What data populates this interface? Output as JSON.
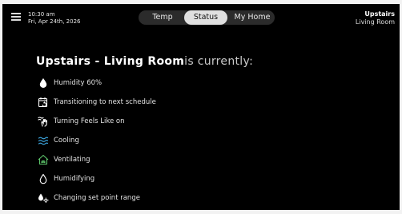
{
  "datetime": {
    "time": "10:30 am",
    "date": "Fri, Apr 24th, 2026"
  },
  "tabs": [
    {
      "label": "Temp"
    },
    {
      "label": "Status"
    },
    {
      "label": "My Home"
    }
  ],
  "location": {
    "floor": "Upstairs",
    "room": "Living Room"
  },
  "headline": {
    "room": "Upstairs - Living Room",
    "suffix": "is currently:"
  },
  "status_items": [
    {
      "icon": "water-drop-icon",
      "label": "Humidity 60%"
    },
    {
      "icon": "calendar-schedule-icon",
      "label": "Transitioning to next schedule"
    },
    {
      "icon": "hand-wave-icon",
      "label": "Turning Feels Like on"
    },
    {
      "icon": "cooling-waves-icon",
      "label": "Cooling"
    },
    {
      "icon": "home-fan-icon",
      "label": "Ventilating"
    },
    {
      "icon": "humidifier-drop-icon",
      "label": "Humidifying"
    },
    {
      "icon": "setpoint-range-icon",
      "label": "Changing set point range"
    }
  ],
  "colors": {
    "background": "#000000",
    "text": "#ffffff",
    "cooling_accent": "#3aa0d8",
    "ventilating_accent": "#5cc36a",
    "active_tab": "#e0e0e0"
  }
}
